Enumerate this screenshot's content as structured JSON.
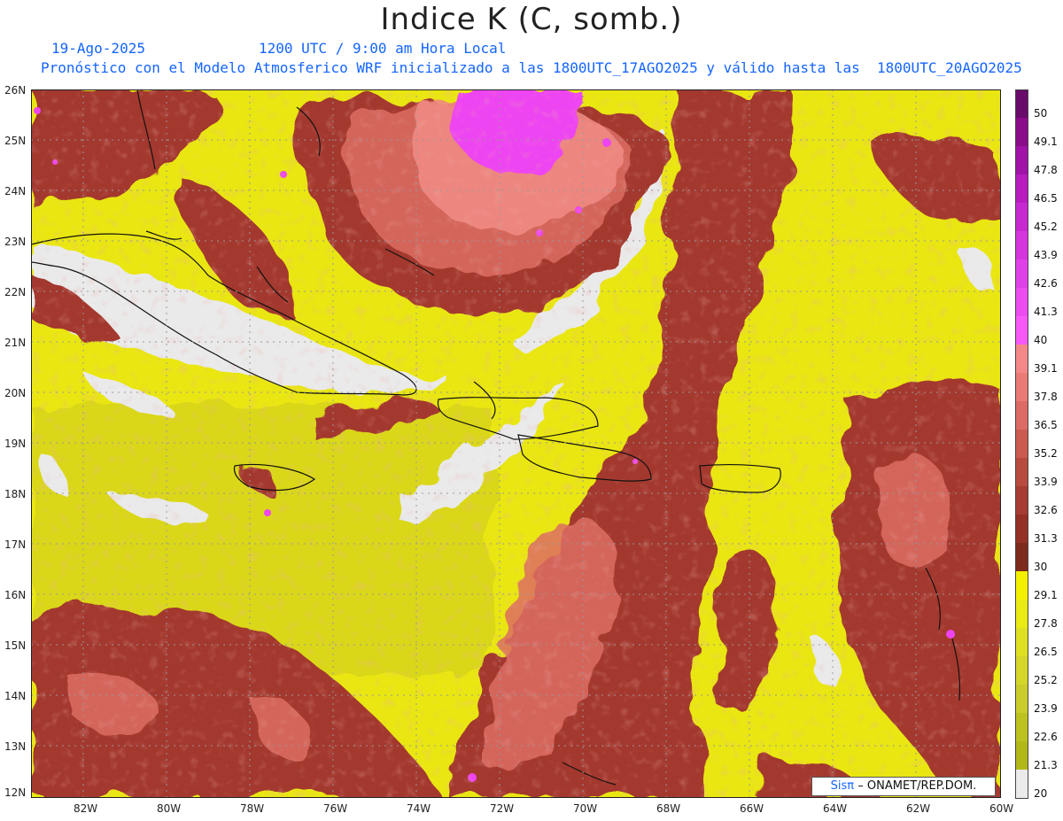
{
  "header": {
    "title": "Indice K (C, somb.)",
    "date": "19-Ago-2025",
    "time": "1200 UTC / 9:00 am Hora Local",
    "description": "Pronóstico con el Modelo Atmosferico WRF inicializado a las 1800UTC_17AGO2025 y válido hasta las  1800UTC_20AGO2025"
  },
  "axes": {
    "lat_labels": [
      "26N",
      "25N",
      "24N",
      "23N",
      "22N",
      "21N",
      "20N",
      "19N",
      "18N",
      "17N",
      "16N",
      "15N",
      "14N",
      "13N",
      "12N"
    ],
    "lon_labels": [
      "82W",
      "80W",
      "78W",
      "76W",
      "74W",
      "72W",
      "70W",
      "68W",
      "66W",
      "64W",
      "62W",
      "60W"
    ]
  },
  "legend": {
    "levels": [
      "50",
      "49.1",
      "47.8",
      "46.5",
      "45.2",
      "43.9",
      "42.6",
      "41.3",
      "40",
      "39.1",
      "37.8",
      "36.5",
      "35.2",
      "33.9",
      "32.6",
      "31.3",
      "30",
      "29.1",
      "27.8",
      "26.5",
      "25.2",
      "23.9",
      "22.6",
      "21.3",
      "20"
    ],
    "colors": [
      "#6a0a6a",
      "#8a0c8a",
      "#a012a8",
      "#b81cc0",
      "#c828d2",
      "#d634df",
      "#e040ea",
      "#ec4cf2",
      "#f858f8",
      "#f48888",
      "#eb7a74",
      "#dd6a64",
      "#cc5a50",
      "#b84a40",
      "#a63c32",
      "#943024",
      "#7e2a1c",
      "#f4f000",
      "#eaea14",
      "#dfe022",
      "#d4d62a",
      "#c9cc2a",
      "#beC220",
      "#b2b818",
      "#ebebeb"
    ]
  },
  "credit": {
    "brand": "Sisπ",
    "org": "– ONAMET/REP.DOM."
  }
}
